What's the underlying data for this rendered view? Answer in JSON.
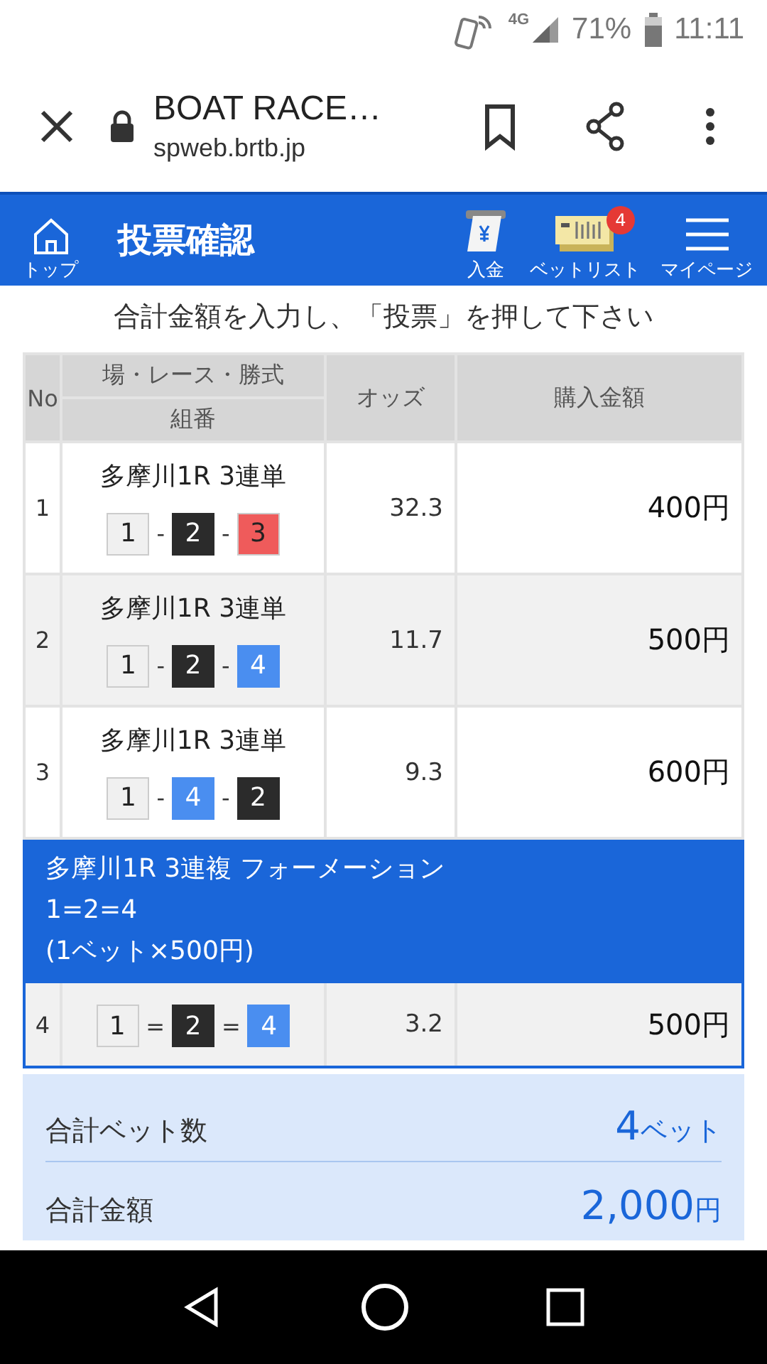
{
  "status_bar": {
    "network": "4G",
    "battery": "71%",
    "time": "11:11"
  },
  "browser": {
    "title": "BOAT RACE…",
    "url": "spweb.brtb.jp"
  },
  "header": {
    "home_label": "トップ",
    "title": "投票確認",
    "actions": [
      {
        "kind": "deposit",
        "label": "入金"
      },
      {
        "kind": "betlist",
        "label": "ベットリスト",
        "badge": "4"
      },
      {
        "kind": "menu",
        "label": "マイページ"
      }
    ]
  },
  "instruction": "合計金額を入力し、「投票」を押して下さい",
  "table": {
    "columns": {
      "no": "No",
      "race_top": "場・レース・勝式",
      "race_bottom": "組番",
      "odds": "オッズ",
      "amount": "購入金額"
    },
    "rows": [
      {
        "kind": "single",
        "no": "1",
        "race": "多摩川1R 3連単",
        "combination": {
          "separator": "-",
          "boats": [
            {
              "number": "1",
              "color": "#f0f0f0"
            },
            {
              "number": "2",
              "color": "#2b2b2b"
            },
            {
              "number": "3",
              "color": "#ef5b5b"
            }
          ]
        },
        "odds": "32.3",
        "amount": "400円"
      },
      {
        "kind": "single",
        "no": "2",
        "race": "多摩川1R 3連単",
        "combination": {
          "separator": "-",
          "boats": [
            {
              "number": "1",
              "color": "#f0f0f0"
            },
            {
              "number": "2",
              "color": "#2b2b2b"
            },
            {
              "number": "4",
              "color": "#4a8ef0"
            }
          ]
        },
        "odds": "11.7",
        "amount": "500円"
      },
      {
        "kind": "single",
        "no": "3",
        "race": "多摩川1R 3連単",
        "combination": {
          "separator": "-",
          "boats": [
            {
              "number": "1",
              "color": "#f0f0f0"
            },
            {
              "number": "4",
              "color": "#4a8ef0"
            },
            {
              "number": "2",
              "color": "#2b2b2b"
            }
          ]
        },
        "odds": "9.3",
        "amount": "600円"
      },
      {
        "kind": "formation",
        "lines": [
          "多摩川1R 3連複 フォーメーション",
          "1=2=4",
          "(1ベット×500円)"
        ],
        "rows": [
          {
            "no": "4",
            "combination": {
              "separator": "=",
              "boats": [
                {
                  "number": "1",
                  "color": "#f0f0f0"
                },
                {
                  "number": "2",
                  "color": "#2b2b2b"
                },
                {
                  "number": "4",
                  "color": "#4a8ef0"
                }
              ]
            },
            "odds": "3.2",
            "amount": "500円"
          }
        ]
      }
    ]
  },
  "summary": [
    {
      "label": "合計ベット数",
      "value": "4",
      "unit": "ベット"
    },
    {
      "label": "合計金額",
      "value": "2,000",
      "unit": "円"
    }
  ]
}
